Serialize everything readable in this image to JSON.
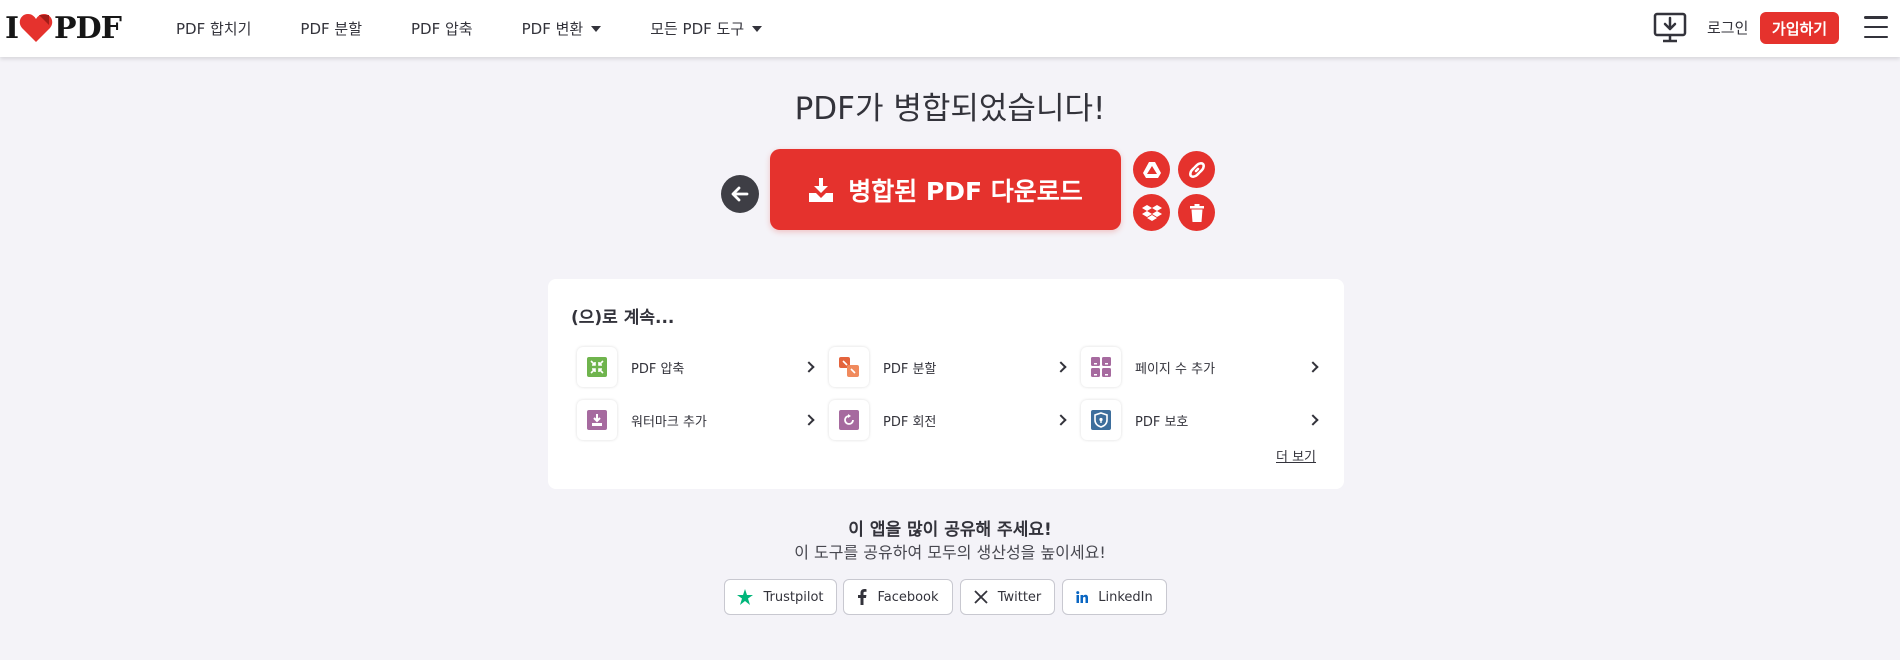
{
  "header": {
    "logo": {
      "left": "I",
      "right": "PDF"
    },
    "nav": [
      {
        "label": "PDF 합치기",
        "dropdown": false
      },
      {
        "label": "PDF 분할",
        "dropdown": false
      },
      {
        "label": "PDF 압축",
        "dropdown": false
      },
      {
        "label": "PDF 변환",
        "dropdown": true
      },
      {
        "label": "모든 PDF 도구",
        "dropdown": true
      }
    ],
    "login_label": "로그인",
    "signup_label": "가입하기"
  },
  "main": {
    "title": "PDF가 병합되었습니다!",
    "download_label": "병합된 PDF 다운로드",
    "side_actions": [
      "google-drive",
      "copy-link",
      "dropbox",
      "delete"
    ]
  },
  "continue": {
    "title": "(으)로 계속...",
    "tools": [
      {
        "label": "PDF 압축",
        "icon": "compress-icon",
        "color": "#6fb44d"
      },
      {
        "label": "PDF 분할",
        "icon": "split-icon",
        "color": "#e4643d"
      },
      {
        "label": "페이지 수 추가",
        "icon": "page-numbers-icon",
        "color": "#a66a9f"
      },
      {
        "label": "워터마크 추가",
        "icon": "watermark-icon",
        "color": "#a66a9f"
      },
      {
        "label": "PDF 회전",
        "icon": "rotate-icon",
        "color": "#a66a9f"
      },
      {
        "label": "PDF 보호",
        "icon": "protect-icon",
        "color": "#3d6e9c"
      }
    ],
    "more_label": "더 보기"
  },
  "share": {
    "title": "이 앱을 많이 공유해 주세요!",
    "subtitle": "이 도구를 공유하여 모두의 생산성을 높이세요!",
    "buttons": [
      {
        "label": "Trustpilot",
        "icon": "trustpilot-icon"
      },
      {
        "label": "Facebook",
        "icon": "facebook-icon"
      },
      {
        "label": "Twitter",
        "icon": "twitter-x-icon"
      },
      {
        "label": "LinkedIn",
        "icon": "linkedin-icon"
      }
    ]
  },
  "colors": {
    "brand": "#e5322d",
    "background": "#f4f3f8",
    "text": "#33333b"
  }
}
